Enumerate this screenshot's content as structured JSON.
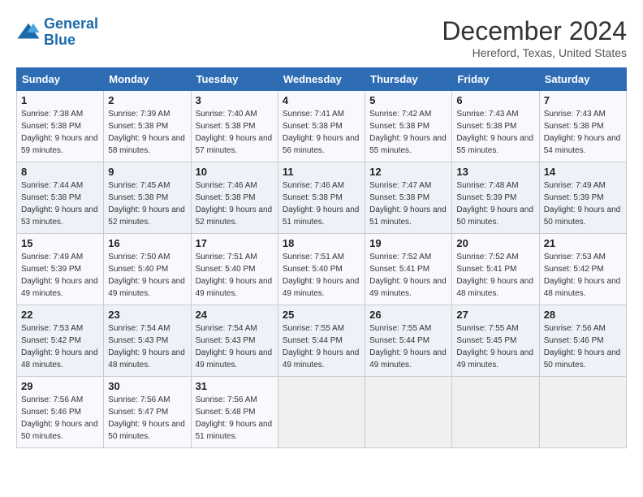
{
  "logo": {
    "line1": "General",
    "line2": "Blue"
  },
  "title": "December 2024",
  "subtitle": "Hereford, Texas, United States",
  "days_of_week": [
    "Sunday",
    "Monday",
    "Tuesday",
    "Wednesday",
    "Thursday",
    "Friday",
    "Saturday"
  ],
  "weeks": [
    [
      {
        "day": 1,
        "sunrise": "7:38 AM",
        "sunset": "5:38 PM",
        "daylight": "9 hours and 59 minutes."
      },
      {
        "day": 2,
        "sunrise": "7:39 AM",
        "sunset": "5:38 PM",
        "daylight": "9 hours and 58 minutes."
      },
      {
        "day": 3,
        "sunrise": "7:40 AM",
        "sunset": "5:38 PM",
        "daylight": "9 hours and 57 minutes."
      },
      {
        "day": 4,
        "sunrise": "7:41 AM",
        "sunset": "5:38 PM",
        "daylight": "9 hours and 56 minutes."
      },
      {
        "day": 5,
        "sunrise": "7:42 AM",
        "sunset": "5:38 PM",
        "daylight": "9 hours and 55 minutes."
      },
      {
        "day": 6,
        "sunrise": "7:43 AM",
        "sunset": "5:38 PM",
        "daylight": "9 hours and 55 minutes."
      },
      {
        "day": 7,
        "sunrise": "7:43 AM",
        "sunset": "5:38 PM",
        "daylight": "9 hours and 54 minutes."
      }
    ],
    [
      {
        "day": 8,
        "sunrise": "7:44 AM",
        "sunset": "5:38 PM",
        "daylight": "9 hours and 53 minutes."
      },
      {
        "day": 9,
        "sunrise": "7:45 AM",
        "sunset": "5:38 PM",
        "daylight": "9 hours and 52 minutes."
      },
      {
        "day": 10,
        "sunrise": "7:46 AM",
        "sunset": "5:38 PM",
        "daylight": "9 hours and 52 minutes."
      },
      {
        "day": 11,
        "sunrise": "7:46 AM",
        "sunset": "5:38 PM",
        "daylight": "9 hours and 51 minutes."
      },
      {
        "day": 12,
        "sunrise": "7:47 AM",
        "sunset": "5:38 PM",
        "daylight": "9 hours and 51 minutes."
      },
      {
        "day": 13,
        "sunrise": "7:48 AM",
        "sunset": "5:39 PM",
        "daylight": "9 hours and 50 minutes."
      },
      {
        "day": 14,
        "sunrise": "7:49 AM",
        "sunset": "5:39 PM",
        "daylight": "9 hours and 50 minutes."
      }
    ],
    [
      {
        "day": 15,
        "sunrise": "7:49 AM",
        "sunset": "5:39 PM",
        "daylight": "9 hours and 49 minutes."
      },
      {
        "day": 16,
        "sunrise": "7:50 AM",
        "sunset": "5:40 PM",
        "daylight": "9 hours and 49 minutes."
      },
      {
        "day": 17,
        "sunrise": "7:51 AM",
        "sunset": "5:40 PM",
        "daylight": "9 hours and 49 minutes."
      },
      {
        "day": 18,
        "sunrise": "7:51 AM",
        "sunset": "5:40 PM",
        "daylight": "9 hours and 49 minutes."
      },
      {
        "day": 19,
        "sunrise": "7:52 AM",
        "sunset": "5:41 PM",
        "daylight": "9 hours and 49 minutes."
      },
      {
        "day": 20,
        "sunrise": "7:52 AM",
        "sunset": "5:41 PM",
        "daylight": "9 hours and 48 minutes."
      },
      {
        "day": 21,
        "sunrise": "7:53 AM",
        "sunset": "5:42 PM",
        "daylight": "9 hours and 48 minutes."
      }
    ],
    [
      {
        "day": 22,
        "sunrise": "7:53 AM",
        "sunset": "5:42 PM",
        "daylight": "9 hours and 48 minutes."
      },
      {
        "day": 23,
        "sunrise": "7:54 AM",
        "sunset": "5:43 PM",
        "daylight": "9 hours and 48 minutes."
      },
      {
        "day": 24,
        "sunrise": "7:54 AM",
        "sunset": "5:43 PM",
        "daylight": "9 hours and 49 minutes."
      },
      {
        "day": 25,
        "sunrise": "7:55 AM",
        "sunset": "5:44 PM",
        "daylight": "9 hours and 49 minutes."
      },
      {
        "day": 26,
        "sunrise": "7:55 AM",
        "sunset": "5:44 PM",
        "daylight": "9 hours and 49 minutes."
      },
      {
        "day": 27,
        "sunrise": "7:55 AM",
        "sunset": "5:45 PM",
        "daylight": "9 hours and 49 minutes."
      },
      {
        "day": 28,
        "sunrise": "7:56 AM",
        "sunset": "5:46 PM",
        "daylight": "9 hours and 50 minutes."
      }
    ],
    [
      {
        "day": 29,
        "sunrise": "7:56 AM",
        "sunset": "5:46 PM",
        "daylight": "9 hours and 50 minutes."
      },
      {
        "day": 30,
        "sunrise": "7:56 AM",
        "sunset": "5:47 PM",
        "daylight": "9 hours and 50 minutes."
      },
      {
        "day": 31,
        "sunrise": "7:56 AM",
        "sunset": "5:48 PM",
        "daylight": "9 hours and 51 minutes."
      },
      null,
      null,
      null,
      null
    ]
  ]
}
